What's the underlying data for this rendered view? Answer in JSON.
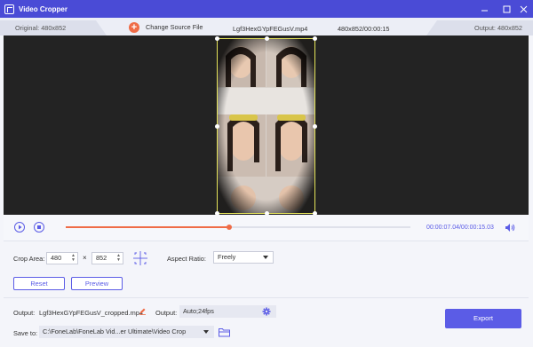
{
  "window": {
    "title": "Video Cropper",
    "controls": [
      "minimize",
      "maximize",
      "close"
    ]
  },
  "info_bar": {
    "original": "Original: 480x852",
    "change_source": "Change Source File",
    "file_name": "Lgf3HexGYpFEGusV.mp4",
    "file_meta": "480x852/00:00:15",
    "output": "Output: 480x852"
  },
  "preview": {
    "icon": "video-frame"
  },
  "playback": {
    "current_time": "00:00:07.04",
    "total_time": "/00:00:15.03",
    "progress": 0.475,
    "accent": "#5b5ce6",
    "progress_color": "#ef6c47"
  },
  "crop": {
    "label": "Crop Area:",
    "width": "480",
    "times": "×",
    "height": "852",
    "aspect_label": "Aspect Ratio:",
    "aspect_value": "Freely",
    "reset": "Reset",
    "preview": "Preview"
  },
  "output": {
    "output_label": "Output:",
    "output_file": "Lgf3HexGYpFEGusV_cropped.mp4",
    "format_label": "Output:",
    "format_value": "Auto;24fps",
    "save_label": "Save to:",
    "save_path": "C:\\FoneLab\\FoneLab Vid...er Ultimate\\Video Crop",
    "export": "Export"
  }
}
